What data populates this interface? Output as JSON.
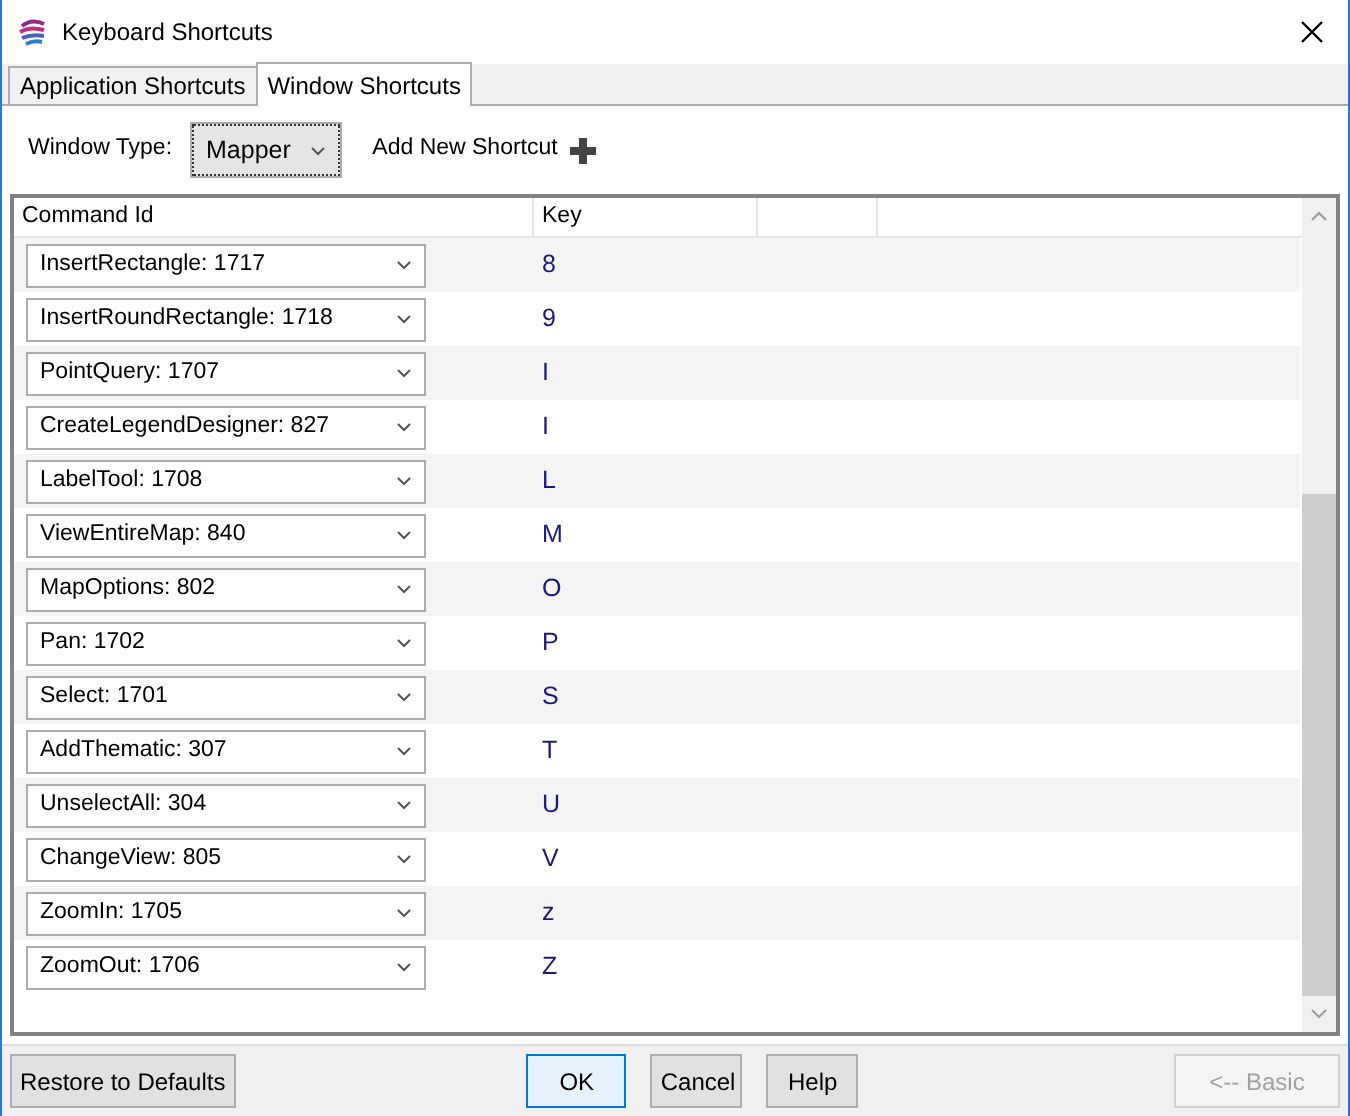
{
  "window": {
    "title": "Keyboard Shortcuts"
  },
  "tabs": [
    {
      "label": "Application Shortcuts",
      "selected": false
    },
    {
      "label": "Window Shortcuts",
      "selected": true
    }
  ],
  "toolbar": {
    "window_type_label": "Window Type:",
    "window_type_value": "Mapper",
    "add_label": "Add New Shortcut"
  },
  "table": {
    "columns": [
      "Command Id",
      "Key"
    ],
    "rows": [
      {
        "command": "InsertRectangle: 1717",
        "key": "8"
      },
      {
        "command": "InsertRoundRectangle: 1718",
        "key": "9"
      },
      {
        "command": "PointQuery: 1707",
        "key": "I"
      },
      {
        "command": "CreateLegendDesigner: 827",
        "key": "I"
      },
      {
        "command": "LabelTool: 1708",
        "key": "L"
      },
      {
        "command": "ViewEntireMap: 840",
        "key": "M"
      },
      {
        "command": "MapOptions: 802",
        "key": "O"
      },
      {
        "command": "Pan: 1702",
        "key": "P"
      },
      {
        "command": "Select: 1701",
        "key": "S"
      },
      {
        "command": "AddThematic: 307",
        "key": "T"
      },
      {
        "command": "UnselectAll: 304",
        "key": "U"
      },
      {
        "command": "ChangeView: 805",
        "key": "V"
      },
      {
        "command": "ZoomIn: 1705",
        "key": "z"
      },
      {
        "command": "ZoomOut: 1706",
        "key": "Z"
      }
    ]
  },
  "buttons": [
    {
      "label": "Restore to Defaults",
      "kind": "left",
      "disabled": false
    },
    {
      "label": "OK",
      "kind": "center",
      "disabled": false,
      "selected": true
    },
    {
      "label": "Cancel",
      "kind": "center",
      "disabled": false,
      "selected": false
    },
    {
      "label": "Help",
      "kind": "center",
      "disabled": false,
      "selected": false
    },
    {
      "label": "<-- Basic",
      "kind": "right",
      "disabled": true
    }
  ]
}
